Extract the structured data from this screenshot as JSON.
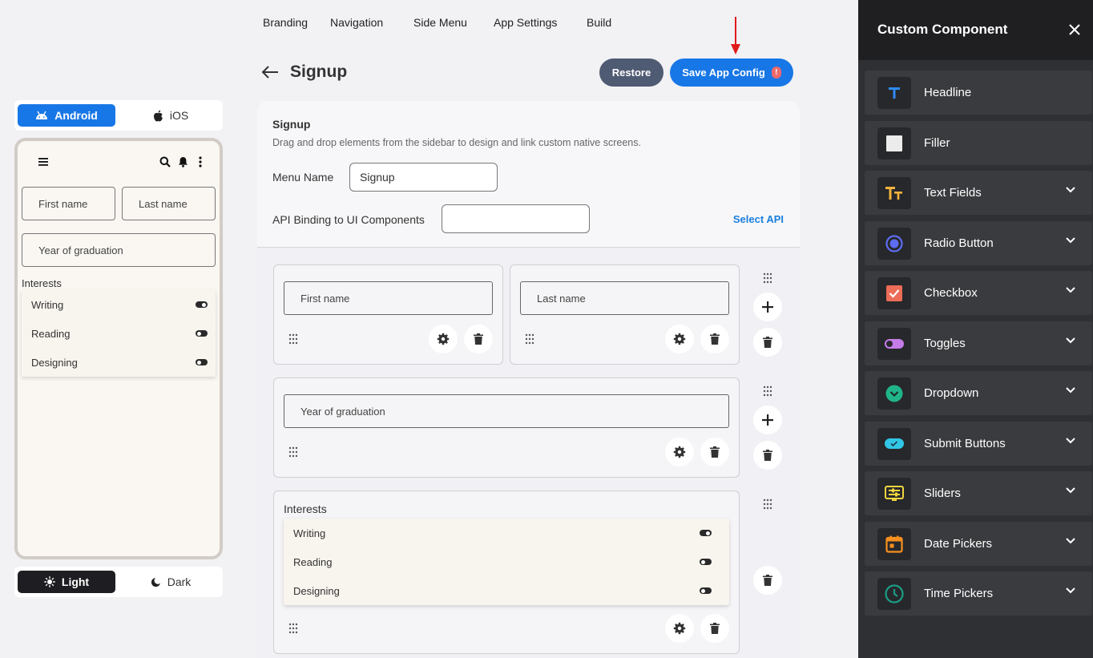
{
  "platform": {
    "android": "Android",
    "ios": "iOS",
    "selected": "android"
  },
  "theme": {
    "light": "Light",
    "dark": "Dark",
    "selected": "light"
  },
  "preview": {
    "first_name": "First name",
    "last_name": "Last name",
    "year": "Year of graduation",
    "interests_label": "Interests",
    "interests": [
      {
        "label": "Writing",
        "on": true
      },
      {
        "label": "Reading",
        "on": false
      },
      {
        "label": "Designing",
        "on": false
      }
    ]
  },
  "nav": [
    "Branding",
    "Navigation",
    "Side Menu",
    "App Settings",
    "Build"
  ],
  "header": {
    "title": "Signup",
    "restore": "Restore",
    "save": "Save App Config",
    "badge": "!"
  },
  "panel": {
    "title": "Signup",
    "description": "Drag and drop elements from the sidebar to design and link custom native screens.",
    "menu_name_label": "Menu Name",
    "menu_name_value": "Signup",
    "api_label": "API Binding to UI Components",
    "api_value": "",
    "select_api": "Select API"
  },
  "canvas": {
    "first_name": "First name",
    "last_name": "Last name",
    "year": "Year of graduation",
    "interests_label": "Interests",
    "interests": [
      {
        "label": "Writing",
        "on": true
      },
      {
        "label": "Reading",
        "on": false
      },
      {
        "label": "Designing",
        "on": false
      }
    ]
  },
  "sidebar": {
    "title": "Custom Component",
    "items": [
      {
        "label": "Headline",
        "icon": "headline-icon",
        "expandable": false
      },
      {
        "label": "Filler",
        "icon": "filler-icon",
        "expandable": false
      },
      {
        "label": "Text Fields",
        "icon": "text-fields-icon",
        "expandable": true
      },
      {
        "label": "Radio Button",
        "icon": "radio-button-icon",
        "expandable": true
      },
      {
        "label": "Checkbox",
        "icon": "checkbox-icon",
        "expandable": true
      },
      {
        "label": "Toggles",
        "icon": "toggle-icon",
        "expandable": true
      },
      {
        "label": "Dropdown",
        "icon": "dropdown-icon",
        "expandable": true
      },
      {
        "label": "Submit Buttons",
        "icon": "submit-button-icon",
        "expandable": true
      },
      {
        "label": "Sliders",
        "icon": "slider-icon",
        "expandable": true
      },
      {
        "label": "Date Pickers",
        "icon": "date-picker-icon",
        "expandable": true
      },
      {
        "label": "Time Pickers",
        "icon": "time-picker-icon",
        "expandable": true
      }
    ]
  },
  "colors": {
    "accent": "#1877e6",
    "restore": "#4f5a73",
    "sidebar_bg": "#2f3033",
    "badge": "#ee6a6a",
    "annotation_arrow": "#e01b1b"
  }
}
